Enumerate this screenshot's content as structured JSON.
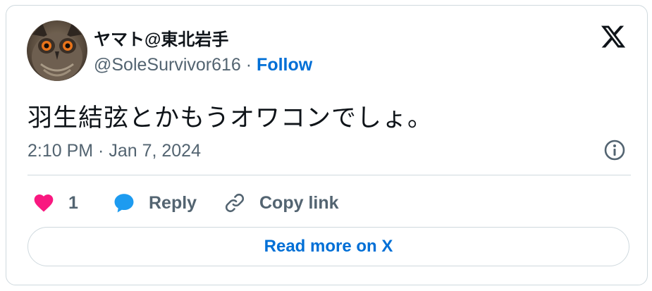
{
  "author": {
    "display_name": "ヤマト@東北岩手",
    "handle": "@SoleSurvivor616",
    "separator": " · ",
    "follow_label": "Follow",
    "avatar_icon": "owl-avatar"
  },
  "tweet": {
    "text": "羽生結弦とかもうオワコンでしょ。",
    "timestamp": "2:10 PM · Jan 7, 2024"
  },
  "actions": {
    "like_count": "1",
    "reply_label": "Reply",
    "copy_link_label": "Copy link"
  },
  "read_more_label": "Read more on X",
  "colors": {
    "like": "#f91880",
    "reply": "#1d9bf0",
    "link": "#006fd6",
    "muted": "#536471",
    "border": "#cfd9de"
  }
}
